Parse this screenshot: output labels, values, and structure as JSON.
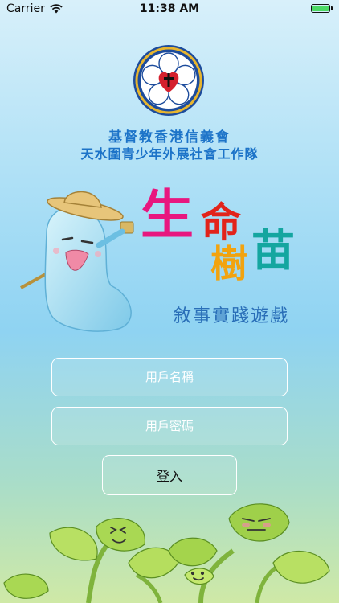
{
  "status_bar": {
    "carrier": "Carrier",
    "time": "11:38 AM",
    "battery_level": 1.0
  },
  "header": {
    "org_name_line1": "基督教香港信義會",
    "org_name_line2": "天水圍青少年外展社會工作隊"
  },
  "title": {
    "char1": "生",
    "char2": "命",
    "char3": "樹",
    "char4": "苗",
    "subtitle": "敘事實踐遊戲"
  },
  "login": {
    "username_placeholder": "用戶名稱",
    "password_placeholder": "用戶密碼",
    "submit_label": "登入"
  },
  "colors": {
    "char1": "#e8177f",
    "char2": "#e2231a",
    "char3": "#f2a30f",
    "char4": "#14a6a0",
    "org_text": "#1c73c8",
    "subtitle": "#2a6fb8"
  }
}
